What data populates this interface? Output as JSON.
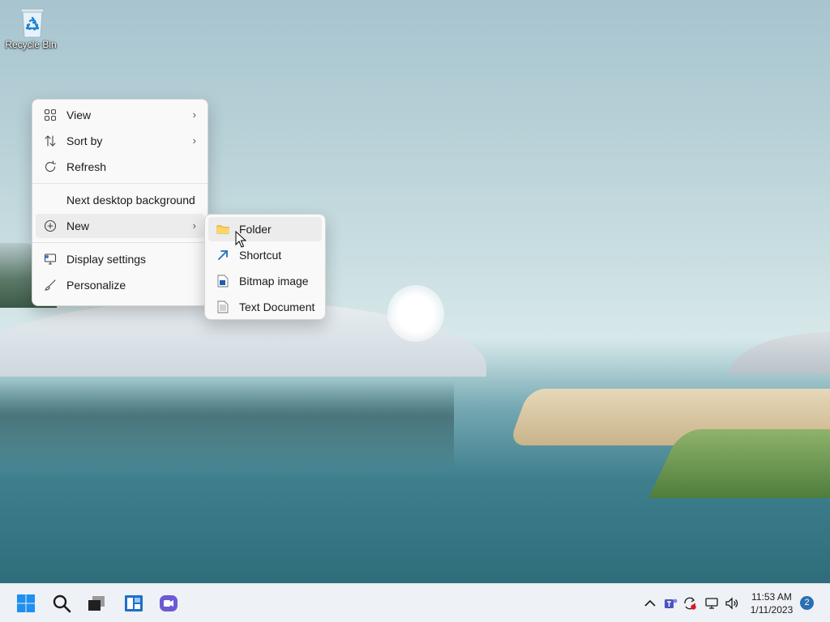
{
  "desktop": {
    "icons": [
      {
        "label": "Recycle Bin",
        "icon": "recycle-bin-icon"
      }
    ]
  },
  "context_menu": {
    "items": [
      {
        "label": "View",
        "icon": "grid-icon",
        "has_submenu": true
      },
      {
        "label": "Sort by",
        "icon": "sort-icon",
        "has_submenu": true
      },
      {
        "label": "Refresh",
        "icon": "refresh-icon",
        "has_submenu": false
      },
      {
        "label": "Next desktop background",
        "icon": "",
        "has_submenu": false
      },
      {
        "label": "New",
        "icon": "plus-circle-icon",
        "has_submenu": true,
        "highlighted": true
      },
      {
        "label": "Display settings",
        "icon": "display-settings-icon",
        "has_submenu": false
      },
      {
        "label": "Personalize",
        "icon": "brush-icon",
        "has_submenu": false
      }
    ]
  },
  "new_submenu": {
    "items": [
      {
        "label": "Folder",
        "icon": "folder-icon",
        "highlighted": true
      },
      {
        "label": "Shortcut",
        "icon": "shortcut-arrow-icon"
      },
      {
        "label": "Bitmap image",
        "icon": "bitmap-image-icon"
      },
      {
        "label": "Text Document",
        "icon": "text-document-icon"
      }
    ]
  },
  "taskbar": {
    "apps": [
      {
        "name": "start",
        "icon": "windows-logo-icon"
      },
      {
        "name": "search",
        "icon": "search-icon"
      },
      {
        "name": "task-view",
        "icon": "task-view-icon"
      },
      {
        "name": "widgets",
        "icon": "widgets-icon"
      },
      {
        "name": "chat",
        "icon": "teams-chat-icon"
      }
    ],
    "tray": {
      "icons": [
        "chevron-up-icon",
        "teams-icon",
        "sync-icon",
        "network-icon",
        "volume-icon"
      ],
      "time": "11:53 AM",
      "date": "1/11/2023",
      "notification_count": "2"
    }
  },
  "colors": {
    "accent": "#0078d4",
    "menu_bg": "#f9f9f9",
    "taskbar_bg": "#eef1f5",
    "folder": "#f7c94b"
  }
}
